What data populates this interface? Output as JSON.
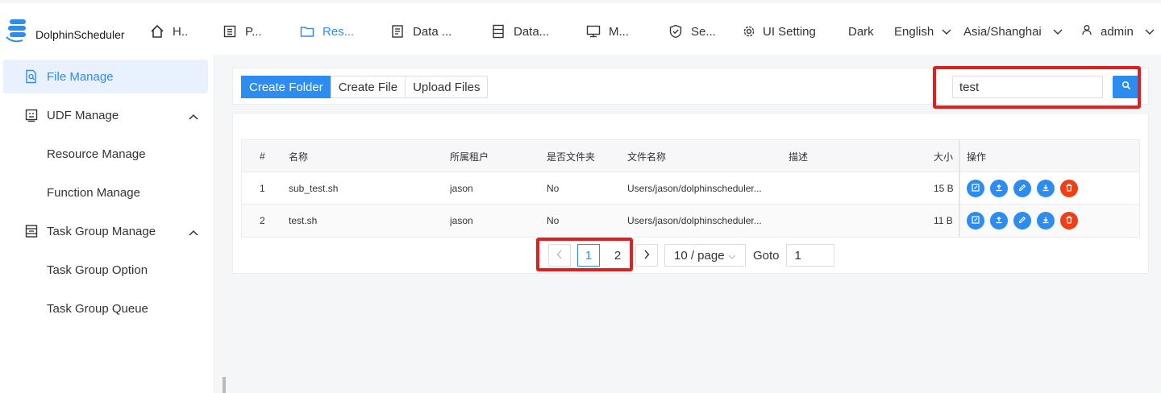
{
  "app": {
    "logo_text": "DolphinScheduler"
  },
  "nav": {
    "items": [
      {
        "label": "H..",
        "icon": "home-icon"
      },
      {
        "label": "P...",
        "icon": "project-icon"
      },
      {
        "label": "Res...",
        "icon": "folder-icon",
        "active": true
      },
      {
        "label": "Data ...",
        "icon": "data-quality-icon"
      },
      {
        "label": "Data...",
        "icon": "datasource-icon"
      },
      {
        "label": "M...",
        "icon": "monitor-icon"
      },
      {
        "label": "Se...",
        "icon": "security-icon"
      },
      {
        "label": "UI Setting",
        "icon": "gear-icon"
      }
    ],
    "theme": "Dark",
    "language": "English",
    "timezone": "Asia/Shanghai",
    "user": "admin"
  },
  "sidebar": {
    "file_manage": "File Manage",
    "udf_manage": "UDF Manage",
    "resource_manage": "Resource Manage",
    "function_manage": "Function Manage",
    "task_group_manage": "Task Group Manage",
    "task_group_option": "Task Group Option",
    "task_group_queue": "Task Group Queue"
  },
  "toolbar": {
    "create_folder": "Create Folder",
    "create_file": "Create File",
    "upload_files": "Upload Files",
    "search_value": "test"
  },
  "table": {
    "headers": [
      "#",
      "名称",
      "所属租户",
      "是否文件夹",
      "文件名称",
      "描述",
      "大小",
      "操作"
    ],
    "rows": [
      {
        "index": "1",
        "name": "sub_test.sh",
        "tenant": "jason",
        "is_folder": "No",
        "file_name": "Users/jason/dolphinscheduler...",
        "desc": "",
        "size": "15 B"
      },
      {
        "index": "2",
        "name": "test.sh",
        "tenant": "jason",
        "is_folder": "No",
        "file_name": "Users/jason/dolphinscheduler...",
        "desc": "",
        "size": "11 B"
      }
    ]
  },
  "pagination": {
    "page1": "1",
    "page2": "2",
    "page_size": "10 / page",
    "goto_label": "Goto",
    "goto_value": "1"
  },
  "colors": {
    "accent": "#2d8cf0",
    "danger": "#ed4014",
    "highlight": "#e02020"
  }
}
